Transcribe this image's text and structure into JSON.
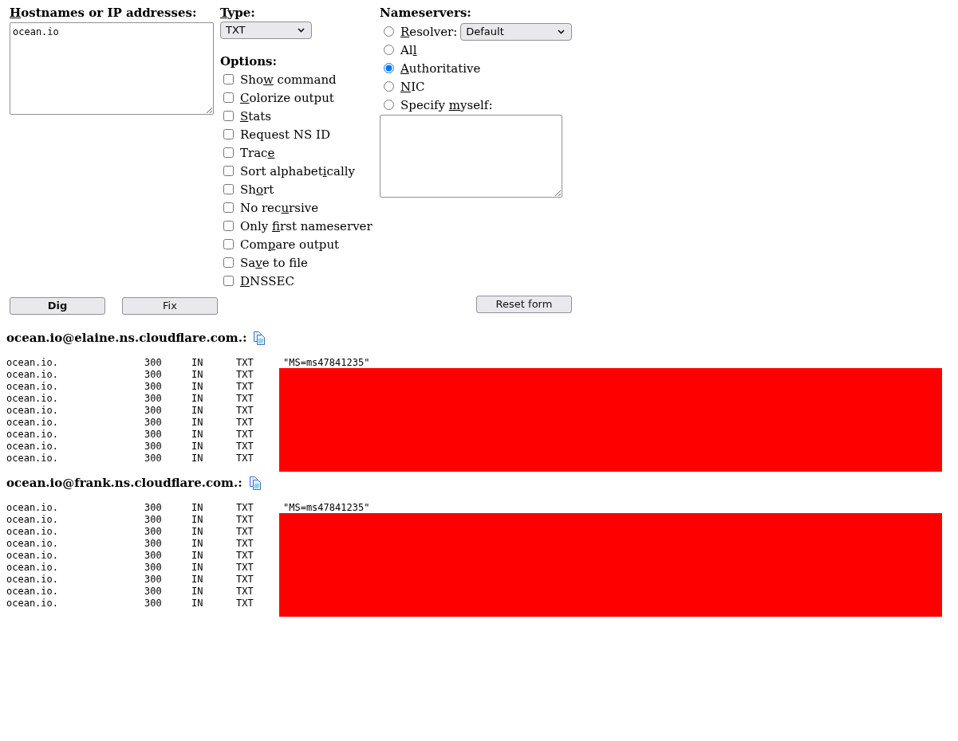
{
  "form": {
    "hostnames": {
      "heading": {
        "access_key": "H",
        "after": "ostnames or IP addresses:"
      },
      "value": "ocean.io"
    },
    "type": {
      "heading": {
        "access_key": "T",
        "after": "ype:"
      },
      "value": "TXT"
    },
    "options": {
      "heading": {
        "text": "Options:"
      },
      "items": [
        {
          "before": "Sho",
          "access_key": "w",
          "after": " command",
          "checked": false
        },
        {
          "access_key": "C",
          "after": "olorize output",
          "checked": false
        },
        {
          "access_key": "S",
          "after": "tats",
          "checked": false
        },
        {
          "text": "Request NS ID",
          "checked": false
        },
        {
          "before": "Trac",
          "access_key": "e",
          "checked": false
        },
        {
          "before": "Sort alphabet",
          "access_key": "i",
          "after": "cally",
          "checked": false
        },
        {
          "before": "Sh",
          "access_key": "o",
          "after": "rt",
          "checked": false
        },
        {
          "before": "No rec",
          "access_key": "u",
          "after": "rsive",
          "checked": false
        },
        {
          "before": "Only ",
          "access_key": "f",
          "after": "irst nameserver",
          "checked": false
        },
        {
          "before": "Com",
          "access_key": "p",
          "after": "are output",
          "checked": false
        },
        {
          "before": "Sa",
          "access_key": "v",
          "after": "e to file",
          "checked": false
        },
        {
          "access_key": "D",
          "after": "NSSEC",
          "checked": false
        }
      ]
    },
    "nameservers": {
      "heading": {
        "text": "Nameservers:"
      },
      "items": [
        {
          "kind": "select",
          "access_key": "R",
          "after": "esolver:",
          "selected": false,
          "value": "Default"
        },
        {
          "kind": "plain",
          "before": "Al",
          "access_key": "l",
          "selected": false
        },
        {
          "kind": "plain",
          "access_key": "A",
          "after": "uthoritative",
          "selected": true
        },
        {
          "kind": "plain",
          "access_key": "N",
          "after": "IC",
          "selected": false
        },
        {
          "kind": "textarea",
          "before": "Specify ",
          "access_key": "m",
          "after": "yself:",
          "selected": false
        }
      ]
    },
    "buttons": [
      {
        "label": "Dig",
        "default": true
      },
      {
        "label": "Fix",
        "default": false
      }
    ],
    "reset_button": {
      "label": "Reset form"
    }
  },
  "results": [
    {
      "heading": "ocean.io@elaine.ns.cloudflare.com.:",
      "redacted": true,
      "records": [
        {
          "name": "ocean.io.",
          "ttl": "300",
          "class": "IN",
          "type": "TXT",
          "data": "\"MS=ms47841235\""
        },
        {
          "name": "ocean.io.",
          "ttl": "300",
          "class": "IN",
          "type": "TXT"
        },
        {
          "name": "ocean.io.",
          "ttl": "300",
          "class": "IN",
          "type": "TXT"
        },
        {
          "name": "ocean.io.",
          "ttl": "300",
          "class": "IN",
          "type": "TXT"
        },
        {
          "name": "ocean.io.",
          "ttl": "300",
          "class": "IN",
          "type": "TXT"
        },
        {
          "name": "ocean.io.",
          "ttl": "300",
          "class": "IN",
          "type": "TXT"
        },
        {
          "name": "ocean.io.",
          "ttl": "300",
          "class": "IN",
          "type": "TXT"
        },
        {
          "name": "ocean.io.",
          "ttl": "300",
          "class": "IN",
          "type": "TXT"
        },
        {
          "name": "ocean.io.",
          "ttl": "300",
          "class": "IN",
          "type": "TXT"
        }
      ]
    },
    {
      "heading": "ocean.io@frank.ns.cloudflare.com.:",
      "redacted": true,
      "records": [
        {
          "name": "ocean.io.",
          "ttl": "300",
          "class": "IN",
          "type": "TXT",
          "data": "\"MS=ms47841235\""
        },
        {
          "name": "ocean.io.",
          "ttl": "300",
          "class": "IN",
          "type": "TXT"
        },
        {
          "name": "ocean.io.",
          "ttl": "300",
          "class": "IN",
          "type": "TXT"
        },
        {
          "name": "ocean.io.",
          "ttl": "300",
          "class": "IN",
          "type": "TXT"
        },
        {
          "name": "ocean.io.",
          "ttl": "300",
          "class": "IN",
          "type": "TXT"
        },
        {
          "name": "ocean.io.",
          "ttl": "300",
          "class": "IN",
          "type": "TXT"
        },
        {
          "name": "ocean.io.",
          "ttl": "300",
          "class": "IN",
          "type": "TXT"
        },
        {
          "name": "ocean.io.",
          "ttl": "300",
          "class": "IN",
          "type": "TXT"
        },
        {
          "name": "ocean.io.",
          "ttl": "300",
          "class": "IN",
          "type": "TXT"
        }
      ]
    }
  ]
}
